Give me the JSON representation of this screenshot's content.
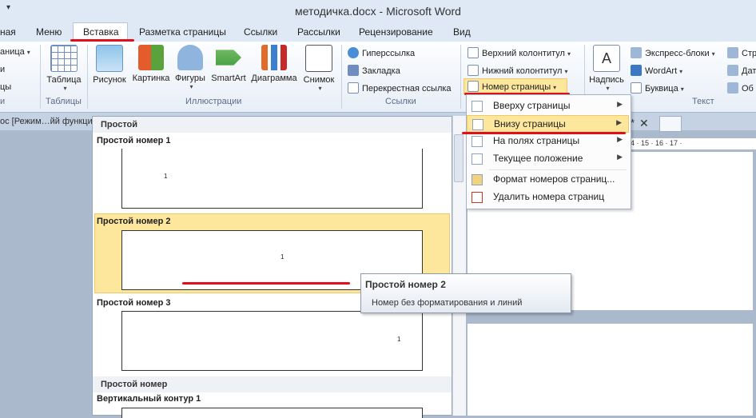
{
  "window": {
    "title": "методичка.docx  -  Microsoft Word"
  },
  "tabs": [
    "ная",
    "Меню",
    "Вставка",
    "Разметка страницы",
    "Ссылки",
    "Рассылки",
    "Рецензирование",
    "Вид"
  ],
  "ribbon": {
    "left_items": [
      "аница",
      "и",
      "цы",
      "и"
    ],
    "tables": {
      "button": "Таблица",
      "group": "Таблицы"
    },
    "illustrations": {
      "buttons": [
        "Рисунок",
        "Картинка",
        "Фигуры",
        "SmartArt",
        "Диаграмма",
        "Снимок"
      ],
      "group": "Иллюстрации"
    },
    "links": {
      "buttons": [
        "Гиперссылка",
        "Закладка",
        "Перекрестная ссылка"
      ],
      "group": "Ссылки"
    },
    "header_footer": {
      "buttons": [
        "Верхний колонтитул",
        "Нижний колонтитул",
        "Номер страницы"
      ]
    },
    "text": {
      "big_button": "Надпись",
      "buttons": [
        "Экспресс-блоки",
        "WordArt",
        "Буквица"
      ],
      "group": "Текст",
      "cut_right": [
        "Стр",
        "Дат",
        "Об"
      ]
    }
  },
  "docbar": {
    "left_text": "ос [Режим…йй функцио",
    "star": "*",
    "close": "✕"
  },
  "ruler": {
    "text": "4 · 15 · 16 · 17 ·"
  },
  "gallery": {
    "section1": "Простой",
    "items": [
      {
        "title": "Простой номер 1",
        "num": "1"
      },
      {
        "title": "Простой номер 2",
        "num": "1"
      },
      {
        "title": "Простой номер 3",
        "num": "1"
      }
    ],
    "section2": "Простой номер",
    "item4": "Вертикальный контур 1"
  },
  "submenu": {
    "items": [
      "Вверху страницы",
      "Внизу страницы",
      "На полях страницы",
      "Текущее положение",
      "Формат номеров страниц...",
      "Удалить номера страниц"
    ]
  },
  "tooltip": {
    "title": "Простой номер 2",
    "desc": "Номер без форматирования и линий"
  }
}
